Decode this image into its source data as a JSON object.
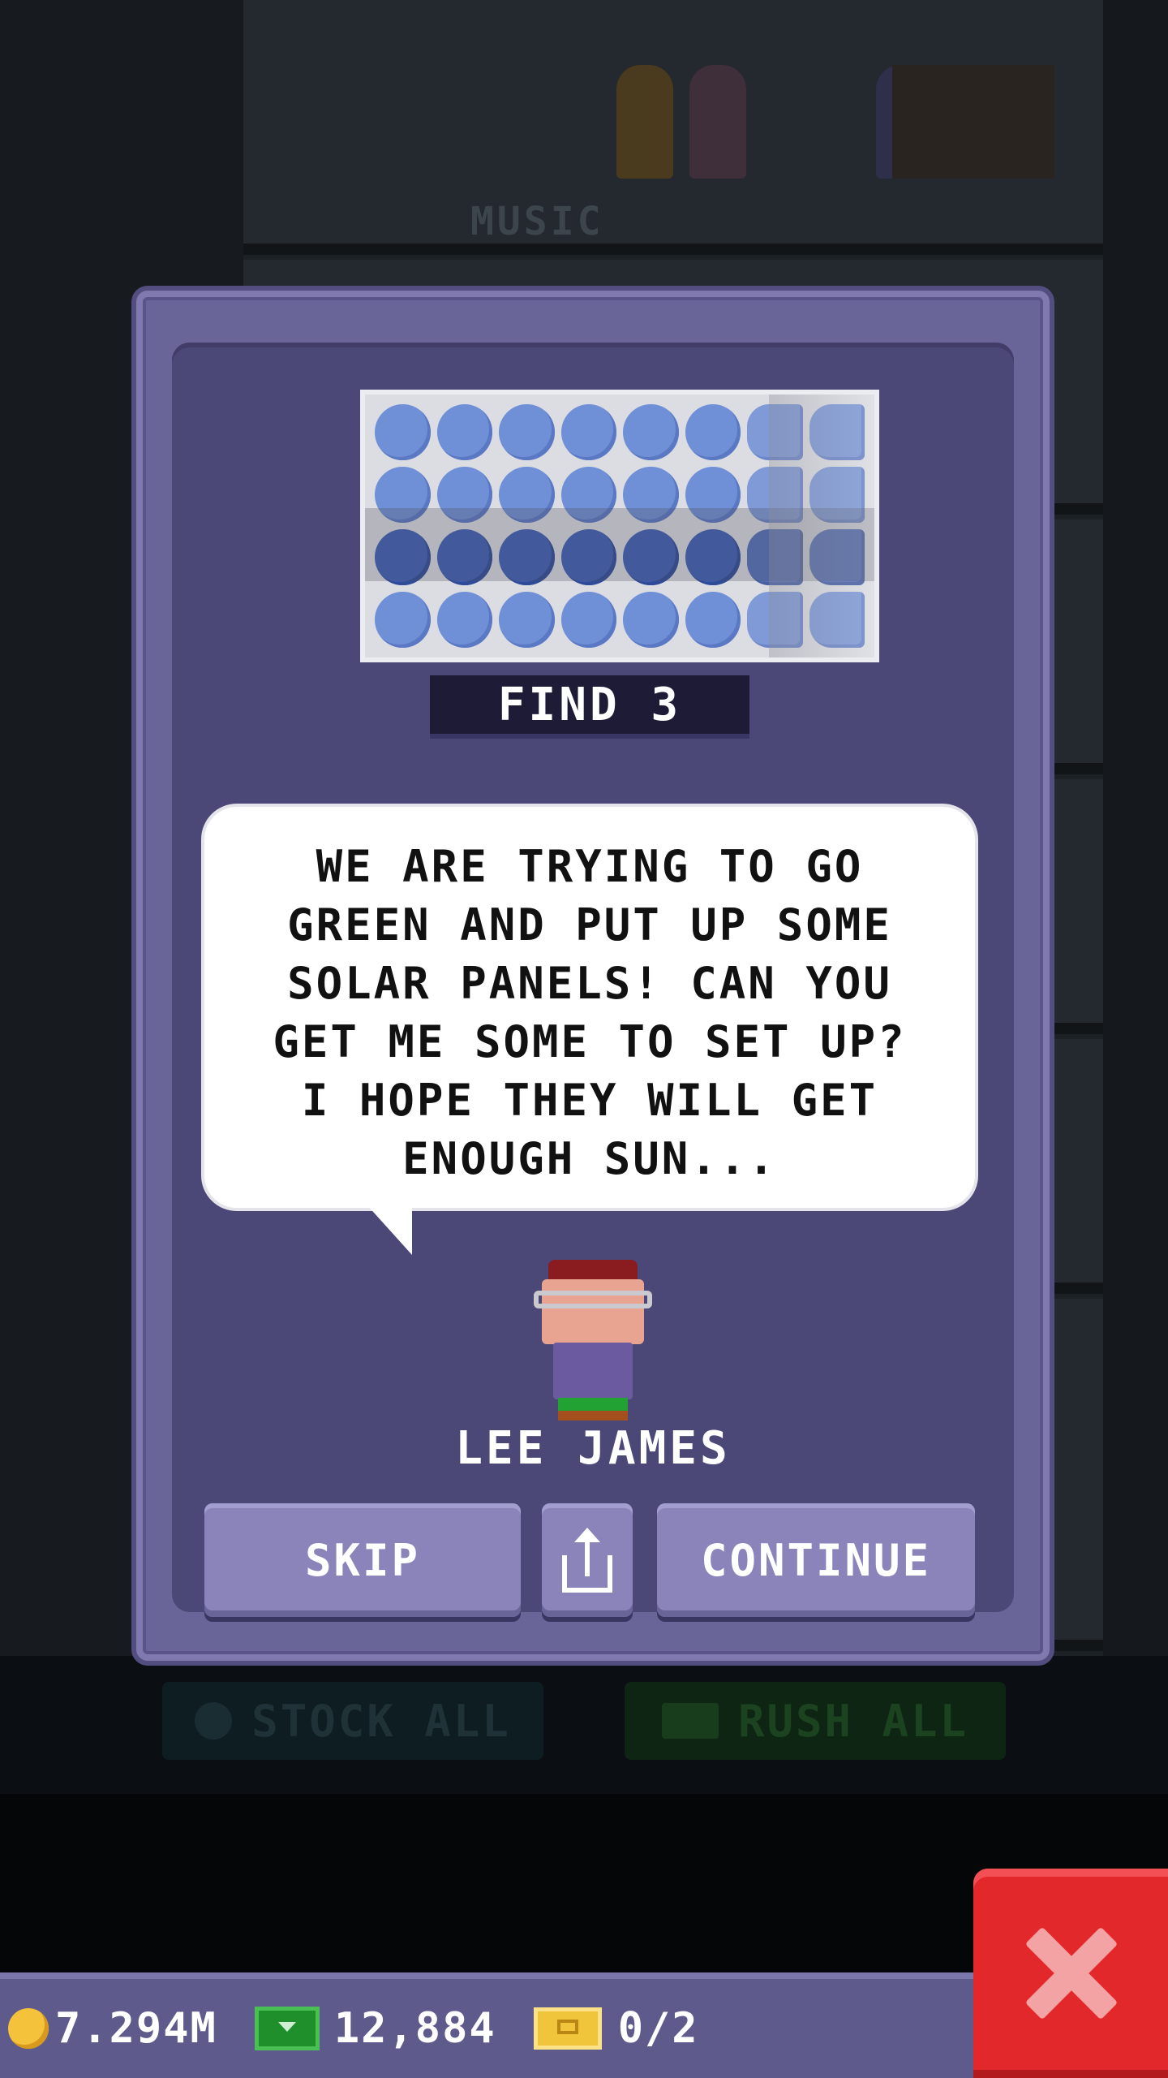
{
  "background": {
    "floor_label": "MUSIC",
    "stock_all_label": "STOCK ALL",
    "rush_all_label": "RUSH ALL"
  },
  "mission": {
    "find_label": "FIND 3",
    "dialogue": "WE ARE TRYING TO GO GREEN AND PUT UP SOME SOLAR PANELS! CAN YOU GET ME SOME TO SET UP? I HOPE THEY WILL GET ENOUGH SUN...",
    "npc_name": "LEE JAMES",
    "item_icon": "solar-panel-icon",
    "avatar_icon": "bitizen-avatar-icon"
  },
  "buttons": {
    "skip_label": "SKIP",
    "share_icon": "share-icon",
    "continue_label": "CONTINUE",
    "close_icon": "close-icon"
  },
  "status_bar": {
    "coins": "7.294M",
    "bux": "12,884",
    "tickets": "0/2"
  },
  "colors": {
    "modal": "#6a6598",
    "modal_inner": "#4b4776",
    "close": "#e3282c",
    "coin": "#f4c33b",
    "bux": "#1f8f2b",
    "ticket": "#f0c53c"
  }
}
